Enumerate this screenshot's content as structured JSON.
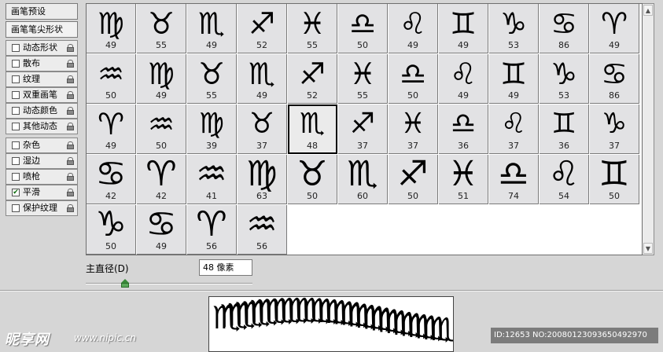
{
  "left_panel": {
    "header_presets": "画笔预设",
    "header_tip_shape": "画笔笔尖形状",
    "options": [
      {
        "label": "动态形状",
        "checked": false
      },
      {
        "label": "散布",
        "checked": false
      },
      {
        "label": "纹理",
        "checked": false
      },
      {
        "label": "双重画笔",
        "checked": false
      },
      {
        "label": "动态颜色",
        "checked": false
      },
      {
        "label": "其他动态",
        "checked": false
      },
      {
        "label": "杂色",
        "checked": false
      },
      {
        "label": "湿边",
        "checked": false
      },
      {
        "label": "喷枪",
        "checked": false
      },
      {
        "label": "平滑",
        "checked": true
      },
      {
        "label": "保护纹理",
        "checked": false
      }
    ]
  },
  "brushes": [
    {
      "glyph": "♍",
      "size": "49",
      "style": "pictorial"
    },
    {
      "glyph": "♉",
      "size": "55",
      "style": "pictorial"
    },
    {
      "glyph": "♏",
      "size": "49",
      "style": "pictorial"
    },
    {
      "glyph": "♐",
      "size": "52",
      "style": "pictorial"
    },
    {
      "glyph": "♓",
      "size": "55",
      "style": "pictorial"
    },
    {
      "glyph": "♎",
      "size": "50",
      "style": "pictorial"
    },
    {
      "glyph": "♌",
      "size": "49",
      "style": "pictorial"
    },
    {
      "glyph": "♊",
      "size": "49",
      "style": "pictorial"
    },
    {
      "glyph": "♑",
      "size": "53",
      "style": "pictorial"
    },
    {
      "glyph": "♋",
      "size": "86",
      "style": "pictorial"
    },
    {
      "glyph": "♈",
      "size": "49",
      "style": "pictorial"
    },
    {
      "glyph": "♒",
      "size": "50",
      "style": "pictorial"
    },
    {
      "glyph": "♍",
      "size": "49",
      "style": "pictorial"
    },
    {
      "glyph": "♉",
      "size": "55",
      "style": "pictorial"
    },
    {
      "glyph": "♏",
      "size": "49",
      "style": "pictorial"
    },
    {
      "glyph": "♐",
      "size": "52",
      "style": "pictorial"
    },
    {
      "glyph": "♓",
      "size": "55",
      "style": "pictorial"
    },
    {
      "glyph": "♎",
      "size": "50",
      "style": "pictorial"
    },
    {
      "glyph": "♌",
      "size": "49",
      "style": "pictorial"
    },
    {
      "glyph": "♊",
      "size": "49",
      "style": "pictorial"
    },
    {
      "glyph": "♑",
      "size": "53",
      "style": "pictorial"
    },
    {
      "glyph": "♋",
      "size": "86",
      "style": "pictorial"
    },
    {
      "glyph": "♈",
      "size": "49",
      "style": "pictorial"
    },
    {
      "glyph": "♒",
      "size": "50",
      "style": "pictorial"
    },
    {
      "glyph": "♍",
      "size": "39",
      "style": "thin"
    },
    {
      "glyph": "♉",
      "size": "37",
      "style": "thin"
    },
    {
      "glyph": "♏",
      "size": "48",
      "style": "thin",
      "selected": true
    },
    {
      "glyph": "♐",
      "size": "37",
      "style": "thin"
    },
    {
      "glyph": "♓",
      "size": "37",
      "style": "thin"
    },
    {
      "glyph": "♎",
      "size": "36",
      "style": "thin"
    },
    {
      "glyph": "♌",
      "size": "37",
      "style": "thin"
    },
    {
      "glyph": "♊",
      "size": "36",
      "style": "thin"
    },
    {
      "glyph": "♑",
      "size": "37",
      "style": "thin"
    },
    {
      "glyph": "♋",
      "size": "42",
      "style": "bold"
    },
    {
      "glyph": "♈",
      "size": "42",
      "style": "bold"
    },
    {
      "glyph": "♒",
      "size": "41",
      "style": "bold"
    },
    {
      "glyph": "♍",
      "size": "63",
      "style": "bold"
    },
    {
      "glyph": "♉",
      "size": "50",
      "style": "bold"
    },
    {
      "glyph": "♏",
      "size": "60",
      "style": "bold"
    },
    {
      "glyph": "♐",
      "size": "50",
      "style": "bold"
    },
    {
      "glyph": "♓",
      "size": "51",
      "style": "bold"
    },
    {
      "glyph": "♎",
      "size": "74",
      "style": "bold"
    },
    {
      "glyph": "♌",
      "size": "54",
      "style": "bold"
    },
    {
      "glyph": "♊",
      "size": "50",
      "style": "bold"
    },
    {
      "glyph": "♑",
      "size": "50",
      "style": "bold"
    },
    {
      "glyph": "♋",
      "size": "49",
      "style": "bold"
    },
    {
      "glyph": "♈",
      "size": "56",
      "style": "bold"
    },
    {
      "glyph": "♒",
      "size": "56",
      "style": "bold"
    }
  ],
  "diameter": {
    "label": "主直径(D)",
    "value": "48 像素",
    "slider_level": 0.22
  },
  "watermark": {
    "logo": "昵享网",
    "url": "www.nipic.cn",
    "id_text": "ID:12653 NO:20080123093650492970"
  },
  "colors": {
    "panel_bg": "#d6d6d6",
    "cell_bg": "#e2e2e4",
    "check_color": "#0a6a0a"
  }
}
